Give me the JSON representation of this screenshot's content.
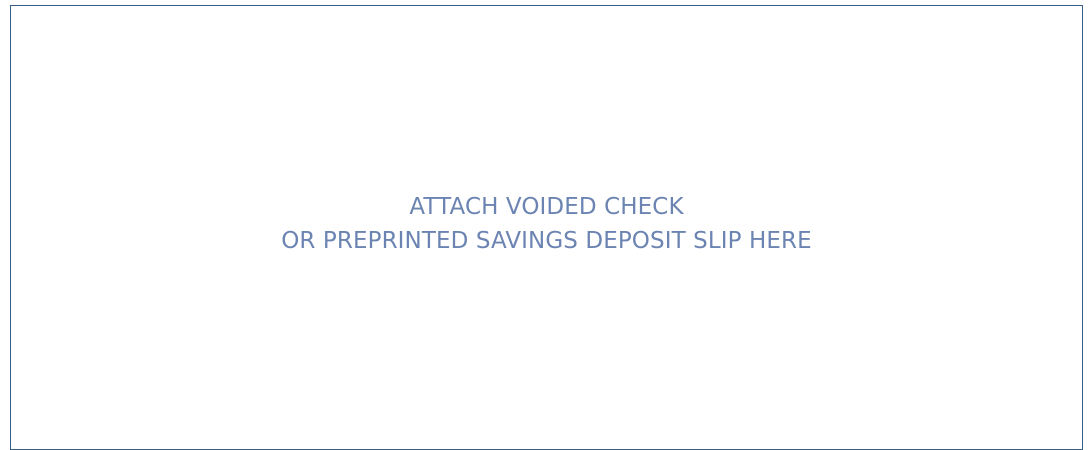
{
  "attachment_area": {
    "line1": "ATTACH VOIDED CHECK",
    "line2": "OR PREPRINTED SAVINGS DEPOSIT SLIP HERE",
    "border_color": "#3a5f86",
    "text_color": "#6c84b2"
  }
}
